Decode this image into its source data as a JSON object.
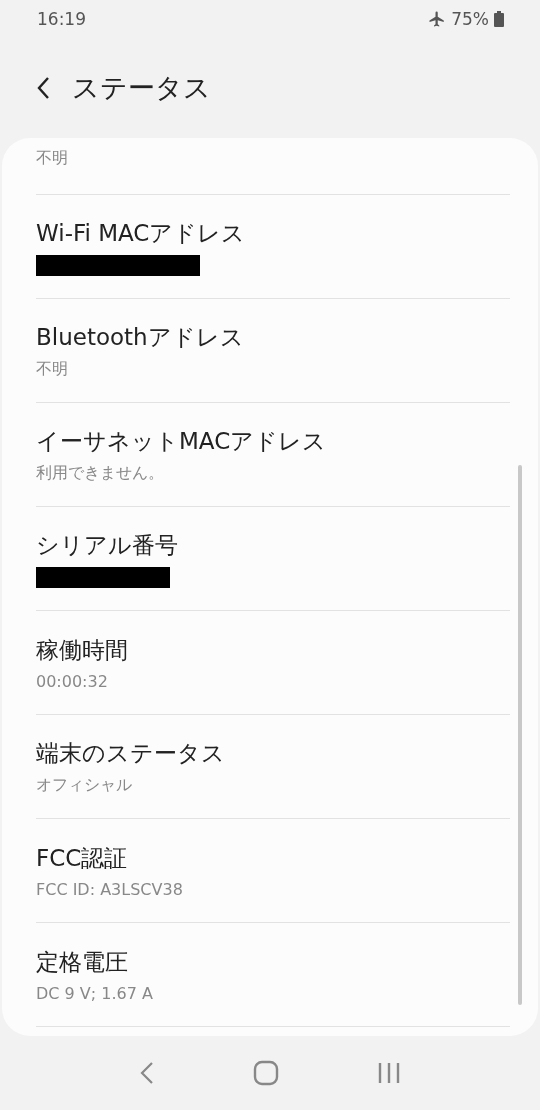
{
  "status_bar": {
    "time": "16:19",
    "battery": "75%"
  },
  "header": {
    "title": "ステータス"
  },
  "items": [
    {
      "kind": "value_only",
      "value": "不明"
    },
    {
      "kind": "redacted",
      "title": "Wi-Fi MACアドレス"
    },
    {
      "kind": "text",
      "title": "Bluetoothアドレス",
      "value": "不明"
    },
    {
      "kind": "text",
      "title": "イーサネットMACアドレス",
      "value": "利用できません。"
    },
    {
      "kind": "redacted",
      "title": "シリアル番号"
    },
    {
      "kind": "text",
      "title": "稼働時間",
      "value": "00:00:32"
    },
    {
      "kind": "text",
      "title": "端末のステータス",
      "value": "オフィシャル"
    },
    {
      "kind": "text",
      "title": "FCC認証",
      "value": "FCC ID: A3LSCV38"
    },
    {
      "kind": "text",
      "title": "定格電圧",
      "value": "DC 9 V; 1.67 A"
    }
  ]
}
